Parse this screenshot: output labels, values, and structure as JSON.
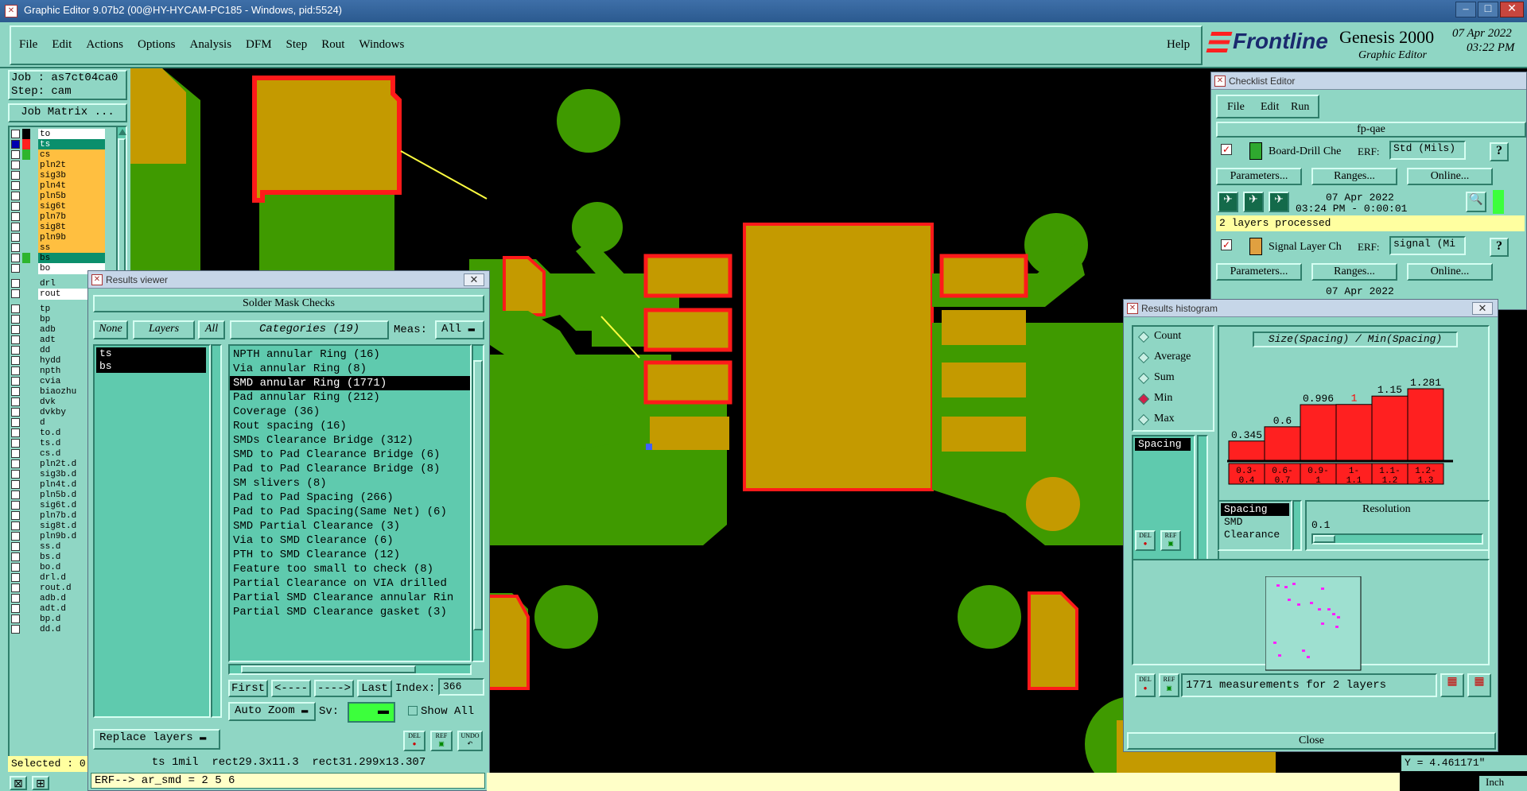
{
  "window_title": "Graphic Editor 9.07b2 (00@HY-HYCAM-PC185 - Windows, pid:5524)",
  "menu": [
    "File",
    "Edit",
    "Actions",
    "Options",
    "Analysis",
    "DFM",
    "Step",
    "Rout",
    "Windows"
  ],
  "help": "Help",
  "brand": {
    "logo": "Frontline",
    "product": "Genesis 2000",
    "subtitle": "Graphic Editor",
    "date": "07 Apr 2022",
    "time": "03:22 PM"
  },
  "job": {
    "job_label": "Job : as7ct04ca0",
    "step_label": "Step: cam",
    "matrix_button": "Job Matrix ..."
  },
  "layers": [
    {
      "name": "to",
      "color": "#000000",
      "bg": "#ffffff"
    },
    {
      "name": "ts",
      "color": "#ff2020",
      "bg": "#0b8f6c",
      "active": true
    },
    {
      "name": "cs",
      "color": "#2db52d",
      "bg": "#ffbf40"
    },
    {
      "name": "pln2t",
      "color": "",
      "bg": "#ffbf40"
    },
    {
      "name": "sig3b",
      "color": "",
      "bg": "#ffbf40"
    },
    {
      "name": "pln4t",
      "color": "",
      "bg": "#ffbf40"
    },
    {
      "name": "pln5b",
      "color": "",
      "bg": "#ffbf40"
    },
    {
      "name": "sig6t",
      "color": "",
      "bg": "#ffbf40"
    },
    {
      "name": "pln7b",
      "color": "",
      "bg": "#ffbf40"
    },
    {
      "name": "sig8t",
      "color": "",
      "bg": "#ffbf40"
    },
    {
      "name": "pln9b",
      "color": "",
      "bg": "#ffbf40"
    },
    {
      "name": "ss",
      "color": "",
      "bg": "#ffbf40"
    },
    {
      "name": "bs",
      "color": "#2db52d",
      "bg": "#0b8f6c"
    },
    {
      "name": "bo",
      "color": "",
      "bg": "#ffffff"
    },
    {
      "name": "drl",
      "color": "",
      "bg": "#8fd6c4"
    },
    {
      "name": "rout",
      "color": "",
      "bg": "#ffffff"
    },
    {
      "name": "tp",
      "color": "",
      "bg": "#8fd6c4"
    },
    {
      "name": "bp",
      "color": "",
      "bg": "#8fd6c4"
    },
    {
      "name": "adb",
      "color": "",
      "bg": "#8fd6c4"
    },
    {
      "name": "adt",
      "color": "",
      "bg": "#8fd6c4"
    },
    {
      "name": "dd",
      "color": "",
      "bg": "#8fd6c4"
    },
    {
      "name": "hydd",
      "color": "",
      "bg": "#8fd6c4"
    },
    {
      "name": "npth",
      "color": "",
      "bg": "#8fd6c4"
    },
    {
      "name": "cvia",
      "color": "",
      "bg": "#8fd6c4"
    },
    {
      "name": "biaozhu",
      "color": "",
      "bg": "#8fd6c4"
    },
    {
      "name": "dvk",
      "color": "",
      "bg": "#8fd6c4"
    },
    {
      "name": "dvkby",
      "color": "",
      "bg": "#8fd6c4"
    },
    {
      "name": "d",
      "color": "",
      "bg": "#8fd6c4"
    },
    {
      "name": "to.d",
      "color": "",
      "bg": "#8fd6c4"
    },
    {
      "name": "ts.d",
      "color": "",
      "bg": "#8fd6c4"
    },
    {
      "name": "cs.d",
      "color": "",
      "bg": "#8fd6c4"
    },
    {
      "name": "pln2t.d",
      "color": "",
      "bg": "#8fd6c4"
    },
    {
      "name": "sig3b.d",
      "color": "",
      "bg": "#8fd6c4"
    },
    {
      "name": "pln4t.d",
      "color": "",
      "bg": "#8fd6c4"
    },
    {
      "name": "pln5b.d",
      "color": "",
      "bg": "#8fd6c4"
    },
    {
      "name": "sig6t.d",
      "color": "",
      "bg": "#8fd6c4"
    },
    {
      "name": "pln7b.d",
      "color": "",
      "bg": "#8fd6c4"
    },
    {
      "name": "sig8t.d",
      "color": "",
      "bg": "#8fd6c4"
    },
    {
      "name": "pln9b.d",
      "color": "",
      "bg": "#8fd6c4"
    },
    {
      "name": "ss.d",
      "color": "",
      "bg": "#8fd6c4"
    },
    {
      "name": "bs.d",
      "color": "",
      "bg": "#8fd6c4"
    },
    {
      "name": "bo.d",
      "color": "",
      "bg": "#8fd6c4"
    },
    {
      "name": "drl.d",
      "color": "",
      "bg": "#8fd6c4"
    },
    {
      "name": "rout.d",
      "color": "",
      "bg": "#8fd6c4"
    },
    {
      "name": "adb.d",
      "color": "",
      "bg": "#8fd6c4"
    },
    {
      "name": "adt.d",
      "color": "",
      "bg": "#8fd6c4"
    },
    {
      "name": "bp.d",
      "color": "",
      "bg": "#8fd6c4"
    },
    {
      "name": "dd.d",
      "color": "",
      "bg": "#8fd6c4"
    }
  ],
  "selected_label": "Selected : 0",
  "results_viewer": {
    "title": "Results viewer",
    "header": "Solder Mask Checks",
    "none_btn": "None",
    "layers_btn": "Layers",
    "all_btn": "All",
    "categories_btn": "Categories (19)",
    "meas_label": "Meas:",
    "meas_value": "All",
    "layer_items": [
      "ts",
      "bs"
    ],
    "categories": [
      "NPTH annular Ring (16)",
      "Via annular Ring (8)",
      "SMD annular Ring (1771)",
      "Pad annular Ring (212)",
      "Coverage (36)",
      "Rout spacing (16)",
      "SMDs Clearance Bridge (312)",
      "SMD to Pad Clearance Bridge (6)",
      "Pad to Pad Clearance Bridge (8)",
      "SM slivers (8)",
      "Pad to Pad Spacing (266)",
      "Pad to Pad Spacing(Same Net) (6)",
      "SMD Partial Clearance (3)",
      "Via to SMD Clearance (6)",
      "PTH to SMD Clearance (12)",
      "Feature too small to check (8)",
      "Partial Clearance on VIA drilled",
      "Partial SMD Clearance annular Rin",
      "Partial SMD Clearance gasket (3)"
    ],
    "selected_category_index": 2,
    "first": "First",
    "prev": "<----",
    "next": "---->",
    "last": "Last",
    "index_label": "Index:",
    "index_value": "366",
    "auto_zoom": "Auto Zoom",
    "sv_label": "Sv:",
    "show_all": "Show All",
    "replace_layers": "Replace layers",
    "icon_labels": [
      "DEL",
      "REF",
      "UNDO"
    ],
    "status_text": "ts 1mil  rect29.3x11.3  rect31.299x13.307"
  },
  "erf_line": "ERF--> ar_smd = 2 5 6",
  "checklist": {
    "title": "Checklist Editor",
    "menu": [
      "File",
      "Edit",
      "Run"
    ],
    "name": "fp-qae",
    "items": [
      {
        "name": "Board-Drill Che",
        "erf_label": "ERF:",
        "erf_value": "Std (Mils)",
        "date": "07 Apr 2022",
        "time": "03:24 PM - 0:00:01",
        "status": "2 layers processed"
      },
      {
        "name": "Signal Layer Ch",
        "erf_label": "ERF:",
        "erf_value": "signal (Mi",
        "date": "07 Apr 2022"
      }
    ],
    "parameters": "Parameters...",
    "ranges": "Ranges...",
    "online": "Online...",
    "question": "?"
  },
  "histogram": {
    "title": "Results histogram",
    "options": [
      "Count",
      "Average",
      "Sum",
      "Min",
      "Max"
    ],
    "selected_option": "Min",
    "heading": "Size(Spacing) / Min(Spacing)",
    "list_items": [
      "Spacing"
    ],
    "bars": [
      {
        "label": "0.345",
        "value": 0.345,
        "range": "0.3-\n0.4"
      },
      {
        "label": "0.6",
        "value": 0.6,
        "range": "0.6-\n0.7"
      },
      {
        "label": "0.996",
        "value": 0.996,
        "range": "0.9-\n1"
      },
      {
        "label": "1",
        "value": 1.0,
        "range": "1-\n1.1"
      },
      {
        "label": "1.15",
        "value": 1.15,
        "range": "1.1-\n1.2"
      },
      {
        "label": "1.281",
        "value": 1.281,
        "range": "1.2-\n1.3"
      }
    ],
    "highlighted_bar": 3,
    "measure_list": [
      "Spacing",
      "SMD",
      "Clearance"
    ],
    "resolution_label": "Resolution",
    "resolution_value": "0.1",
    "summary": "1771 measurements for 2 layers",
    "close": "Close",
    "icon_labels": [
      "DEL",
      "REF"
    ]
  },
  "coords": {
    "y": "Y = 4.461171\"",
    "units": "Inch"
  },
  "colors": {
    "ui_teal": "#8fd6c4",
    "copper_green": "#3f9a00",
    "pad_gold": "#c49a00",
    "mask_red": "#ff1a1a"
  }
}
